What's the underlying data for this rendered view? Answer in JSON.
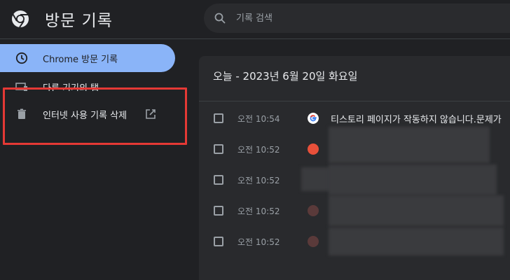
{
  "header": {
    "title": "방문 기록",
    "search_placeholder": "기록 검색",
    "search_value": ""
  },
  "sidebar": {
    "items": [
      {
        "label": "Chrome 방문 기록",
        "icon": "clock-icon",
        "active": true
      },
      {
        "label": "다른 기기의 탭",
        "icon": "devices-icon",
        "active": false
      },
      {
        "label": "인터넷 사용 기록 삭제",
        "icon": "trash-icon",
        "active": false,
        "external": true
      }
    ]
  },
  "history": {
    "date_header": "오늘 - 2023년 6월 20일 화요일",
    "entries": [
      {
        "time": "오전 10:54",
        "title": "티스토리 페이지가 작동하지 않습니다.문제가",
        "favicon": "google-icon"
      },
      {
        "time": "오전 10:52",
        "title": "",
        "favicon": "tistory-icon"
      },
      {
        "time": "오전 10:52",
        "title": "",
        "favicon": "none"
      },
      {
        "time": "오전 10:52",
        "title": "",
        "favicon": "tistory-icon"
      },
      {
        "time": "오전 10:52",
        "title": "",
        "favicon": "tistory-icon"
      }
    ]
  },
  "colors": {
    "background": "#202124",
    "card": "#292a2d",
    "accent": "#8ab4f8",
    "highlight_border": "#e53935"
  }
}
